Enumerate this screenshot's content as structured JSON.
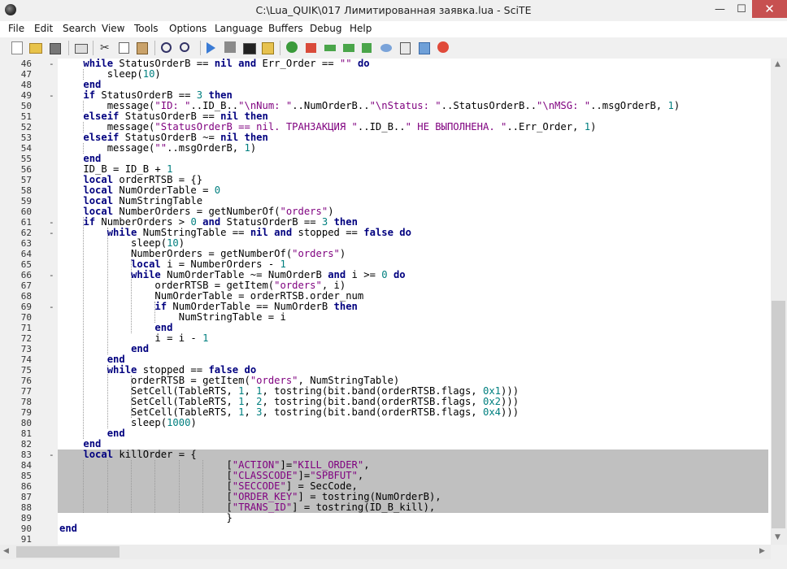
{
  "window": {
    "title": "C:\\Lua_QUIK\\017 Лимитированная заявка.lua - SciTE",
    "min_glyph": "—",
    "max_glyph": "☐",
    "close_glyph": "✕"
  },
  "menu": [
    "File",
    "Edit",
    "Search",
    "View",
    "Tools",
    "Options",
    "Language",
    "Buffers",
    "Debug",
    "Help"
  ],
  "toolbar": [
    "new-icon",
    "open-icon",
    "save-icon",
    "print-icon",
    "cut-icon",
    "copy-icon",
    "paste-icon",
    "find-icon",
    "replace-icon",
    "run-icon",
    "stop-icon",
    "console-icon",
    "build-icon",
    "bug-icon",
    "flag-icon",
    "step-icon",
    "step-over-icon",
    "step-out-icon",
    "watch-icon",
    "calc-icon",
    "export-icon",
    "close-debug-icon"
  ],
  "colors": {
    "keyword": "#00007f",
    "string": "#7f007f",
    "number": "#007f7f",
    "selection": "#c0c0c0",
    "close": "#c75050"
  },
  "editor": {
    "folds": [
      "-",
      "",
      "",
      "-",
      "",
      "",
      "",
      "",
      "",
      "",
      "",
      "",
      "",
      "",
      "",
      "-",
      "-",
      "",
      "",
      "",
      "-",
      "",
      "",
      "-",
      "",
      "",
      "",
      "",
      "",
      "",
      "",
      "",
      "",
      "",
      "",
      "",
      "",
      "-",
      "",
      "",
      "",
      "",
      "",
      "",
      "",
      ""
    ],
    "lines": [
      {
        "n": "46",
        "t": "    while StatusOrderB == nil and Err_Order == \"\" do"
      },
      {
        "n": "47",
        "t": "        sleep(10)"
      },
      {
        "n": "48",
        "t": "    end"
      },
      {
        "n": "49",
        "t": "    if StatusOrderB == 3 then"
      },
      {
        "n": "50",
        "t": "        message(\"ID: \"..ID_B..\"\\nNum: \"..NumOrderB..\"\\nStatus: \"..StatusOrderB..\"\\nMSG: \"..msgOrderB, 1)"
      },
      {
        "n": "51",
        "t": "    elseif StatusOrderB == nil then"
      },
      {
        "n": "52",
        "t": "        message(\"StatusOrderB == nil. ТРАНЗАКЦИЯ \"..ID_B..\" НЕ ВЫПОЛНЕНА. \"..Err_Order, 1)"
      },
      {
        "n": "53",
        "t": "    elseif StatusOrderB ~= nil then"
      },
      {
        "n": "54",
        "t": "        message(\"\"..msgOrderB, 1)"
      },
      {
        "n": "55",
        "t": "    end"
      },
      {
        "n": "56",
        "t": "    ID_B = ID_B + 1"
      },
      {
        "n": "57",
        "t": "    local orderRTSB = {}"
      },
      {
        "n": "58",
        "t": "    local NumOrderTable = 0"
      },
      {
        "n": "59",
        "t": "    local NumStringTable"
      },
      {
        "n": "60",
        "t": "    local NumberOrders = getNumberOf(\"orders\")"
      },
      {
        "n": "61",
        "t": "    if NumberOrders > 0 and StatusOrderB == 3 then"
      },
      {
        "n": "62",
        "t": "        while NumStringTable == nil and stopped == false do"
      },
      {
        "n": "63",
        "t": "            sleep(10)"
      },
      {
        "n": "64",
        "t": "            NumberOrders = getNumberOf(\"orders\")"
      },
      {
        "n": "65",
        "t": "            local i = NumberOrders - 1"
      },
      {
        "n": "66",
        "t": "            while NumOrderTable ~= NumOrderB and i >= 0 do"
      },
      {
        "n": "67",
        "t": "                orderRTSB = getItem(\"orders\", i)"
      },
      {
        "n": "68",
        "t": "                NumOrderTable = orderRTSB.order_num"
      },
      {
        "n": "69",
        "t": "                if NumOrderTable == NumOrderB then"
      },
      {
        "n": "70",
        "t": "                    NumStringTable = i"
      },
      {
        "n": "71",
        "t": "                end"
      },
      {
        "n": "72",
        "t": "                i = i - 1"
      },
      {
        "n": "73",
        "t": "            end"
      },
      {
        "n": "74",
        "t": "        end"
      },
      {
        "n": "75",
        "t": "        while stopped == false do"
      },
      {
        "n": "76",
        "t": "            orderRTSB = getItem(\"orders\", NumStringTable)"
      },
      {
        "n": "77",
        "t": "            SetCell(TableRTS, 1, 1, tostring(bit.band(orderRTSB.flags, 0x1)))"
      },
      {
        "n": "78",
        "t": "            SetCell(TableRTS, 1, 2, tostring(bit.band(orderRTSB.flags, 0x2)))"
      },
      {
        "n": "79",
        "t": "            SetCell(TableRTS, 1, 3, tostring(bit.band(orderRTSB.flags, 0x4)))"
      },
      {
        "n": "80",
        "t": "            sleep(1000)"
      },
      {
        "n": "81",
        "t": "        end"
      },
      {
        "n": "82",
        "t": "    end"
      },
      {
        "n": "83",
        "t": "    local killOrder = {"
      },
      {
        "n": "84",
        "t": "                            [\"ACTION\"]=\"KILL_ORDER\","
      },
      {
        "n": "85",
        "t": "                            [\"CLASSCODE\"]=\"SPBFUT\","
      },
      {
        "n": "86",
        "t": "                            [\"SECCODE\"] = SecCode,"
      },
      {
        "n": "87",
        "t": "                            [\"ORDER_KEY\"] = tostring(NumOrderB),"
      },
      {
        "n": "88",
        "t": "                            [\"TRANS_ID\"] = tostring(ID_B_kill),"
      },
      {
        "n": "89",
        "t": "                            }"
      },
      {
        "n": "90",
        "t": "end"
      },
      {
        "n": "91",
        "t": ""
      }
    ]
  }
}
